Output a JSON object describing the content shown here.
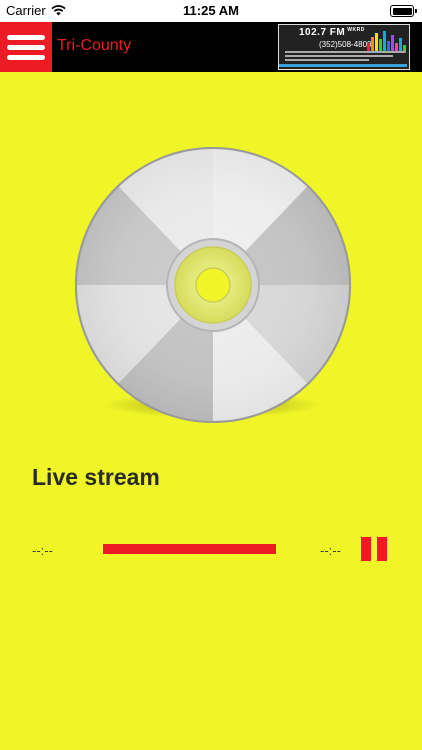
{
  "status_bar": {
    "carrier": "Carrier",
    "time": "11:25 AM"
  },
  "nav": {
    "title": "Tri-County",
    "logo": {
      "frequency": "102.7 FM",
      "call_sign": "WKRD",
      "phone": "(352)508-4800"
    }
  },
  "player": {
    "stream_title": "Live stream",
    "elapsed": "--:--",
    "remaining": "--:--",
    "progress": 1.0
  },
  "colors": {
    "background": "#f0f528",
    "accent": "#ed1c24",
    "nav_background": "#000000"
  },
  "icons": {
    "menu": "hamburger-icon",
    "pause": "pause-icon",
    "wifi": "wifi-icon",
    "battery": "battery-icon"
  }
}
